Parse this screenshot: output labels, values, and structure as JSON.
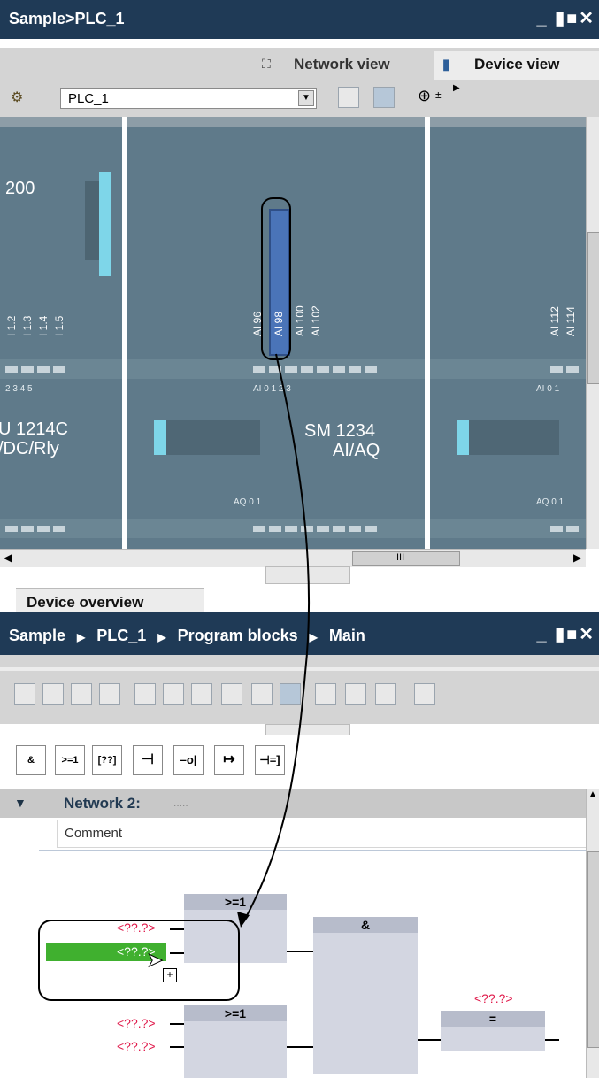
{
  "device_window": {
    "title": "Sample>PLC_1",
    "window_controls": "_ ▮■✕",
    "tabs": {
      "network_view": "Network view",
      "device_view": "Device view"
    },
    "device_select": "PLC_1",
    "modules": {
      "cpu": {
        "label_top": "200",
        "line1": "U 1214C",
        "line2": "/DC/Rly",
        "io_labels": [
          "I 1.2",
          "I 1.3",
          "I 1.4",
          "I 1.5"
        ],
        "pin_nums": "2  3  4  5"
      },
      "sm1234": {
        "line1": "SM 1234",
        "line2": "AI/AQ",
        "ai_labels": [
          "AI 96",
          "AI 98",
          "AI 100",
          "AI 102"
        ],
        "pin_nums": "AI 0   1   2   3",
        "aq_nums": "AQ 0   1"
      },
      "right": {
        "ai_labels": [
          "AI 112",
          "AI 114"
        ],
        "pin_nums": "AI 0   1",
        "aq_nums": "AQ 0   1"
      }
    },
    "hscroll_mark": "III",
    "overview_tab": "Device overview"
  },
  "editor_window": {
    "breadcrumb": [
      "Sample",
      "PLC_1",
      "Program blocks",
      "Main"
    ],
    "window_controls": "_ ▮■✕",
    "instructions": [
      "&",
      ">=1",
      "[??]",
      "⊣",
      "–o|",
      "↦",
      "⊣=]"
    ],
    "network_title": "Network 2:",
    "network_dots": ".....",
    "comment": "Comment",
    "placeholder": "<??.?>",
    "blocks": {
      "or1": ">=1",
      "and": "&",
      "or2": ">=1",
      "assign": "="
    },
    "drag_plus": "+"
  }
}
